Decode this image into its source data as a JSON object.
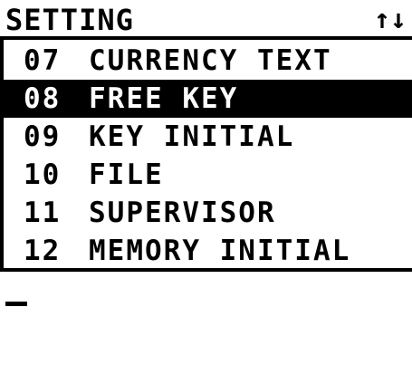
{
  "header": {
    "title": "SETTING",
    "scroll_indicator": "↑↓"
  },
  "menu": {
    "selected_index": 1,
    "items": [
      {
        "number": "07",
        "label": "CURRENCY TEXT"
      },
      {
        "number": "08",
        "label": "FREE KEY"
      },
      {
        "number": "09",
        "label": "KEY INITIAL"
      },
      {
        "number": "10",
        "label": "FILE"
      },
      {
        "number": "11",
        "label": "SUPERVISOR"
      },
      {
        "number": "12",
        "label": "MEMORY INITIAL"
      }
    ]
  },
  "input": {
    "value": ""
  },
  "colors": {
    "foreground": "#000000",
    "background": "#ffffff",
    "selected_background": "#000000",
    "selected_foreground": "#ffffff"
  }
}
